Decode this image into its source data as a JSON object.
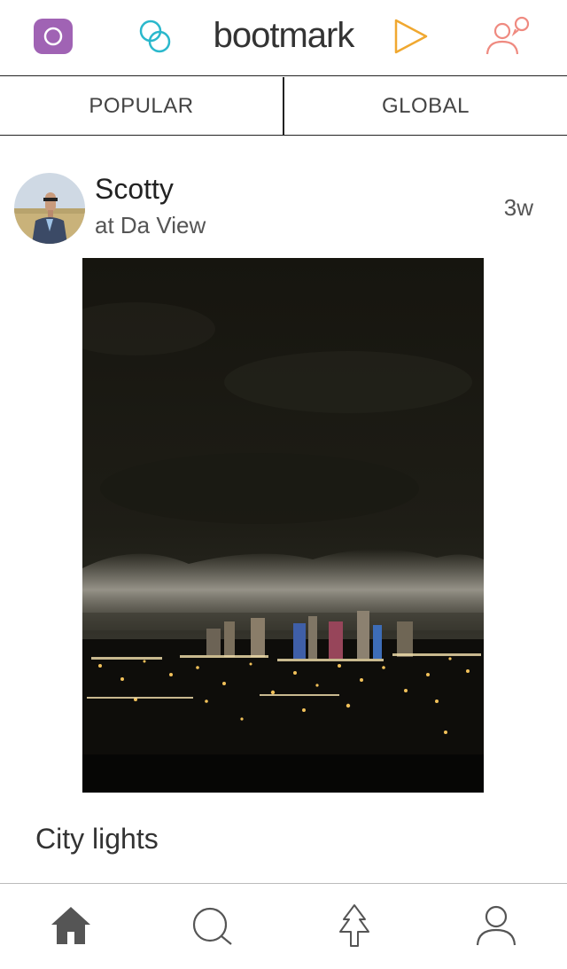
{
  "header": {
    "logo_text": "bootmark",
    "colors": {
      "purple": "#a063b4",
      "teal": "#2ab8cc",
      "orange": "#f0a830",
      "coral": "#ef8a80"
    },
    "icons": [
      "record-icon",
      "circles-icon",
      "play-icon",
      "people-chat-icon"
    ]
  },
  "tabs": [
    {
      "label": "POPULAR"
    },
    {
      "label": "GLOBAL"
    }
  ],
  "post": {
    "username": "Scotty",
    "location": "at Da View",
    "time_ago": "3w",
    "caption": "City lights"
  },
  "bottom_nav": [
    "home-icon",
    "search-icon",
    "tree-icon",
    "profile-icon"
  ]
}
